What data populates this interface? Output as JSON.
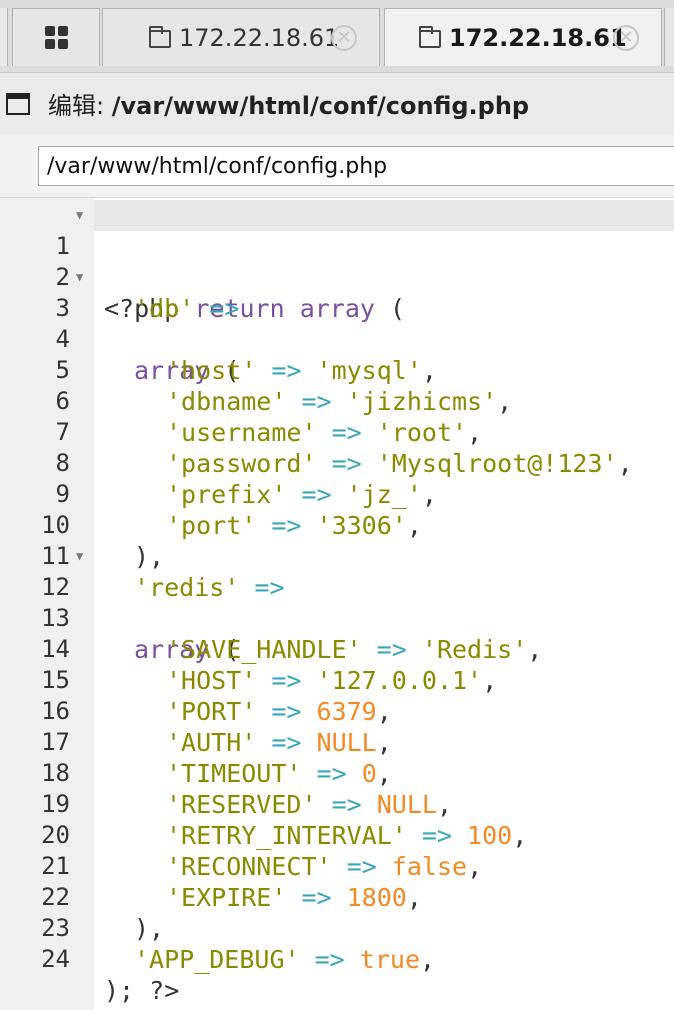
{
  "tabs": [
    {
      "label": "172.22.18.61",
      "active": false
    },
    {
      "label": "172.22.18.61",
      "active": true
    }
  ],
  "title": {
    "prefix": "编辑: ",
    "path": "/var/www/html/conf/config.php"
  },
  "path_input": {
    "value": "/var/www/html/conf/config.php"
  },
  "editor": {
    "lines": [
      {
        "n": "1"
      },
      {
        "n": "2"
      },
      {
        "n": "3"
      },
      {
        "n": "4"
      },
      {
        "n": "5"
      },
      {
        "n": "6"
      },
      {
        "n": "7"
      },
      {
        "n": "8"
      },
      {
        "n": "9"
      },
      {
        "n": "10"
      },
      {
        "n": "11"
      },
      {
        "n": "12"
      },
      {
        "n": "13"
      },
      {
        "n": "14"
      },
      {
        "n": "15"
      },
      {
        "n": "16"
      },
      {
        "n": "17"
      },
      {
        "n": "18"
      },
      {
        "n": "19"
      },
      {
        "n": "20"
      },
      {
        "n": "21"
      },
      {
        "n": "22"
      },
      {
        "n": "23"
      },
      {
        "n": "24"
      }
    ],
    "code": {
      "l1": [
        "<?php ",
        "return",
        " ",
        "array",
        " ("
      ],
      "l2": [
        "'db'",
        " =>"
      ],
      "l3": [
        "array",
        " ("
      ],
      "l4": [
        "'host'",
        " => ",
        "'mysql'",
        ","
      ],
      "l5": [
        "'dbname'",
        " => ",
        "'jizhicms'",
        ","
      ],
      "l6": [
        "'username'",
        " => ",
        "'root'",
        ","
      ],
      "l7": [
        "'password'",
        " => ",
        "'Mysqlroot@!123'",
        ","
      ],
      "l8": [
        "'prefix'",
        " => ",
        "'jz_'",
        ","
      ],
      "l9": [
        "'port'",
        " => ",
        "'3306'",
        ","
      ],
      "l10": [
        "),"
      ],
      "l11": [
        "'redis'",
        " =>"
      ],
      "l12": [
        "array",
        " ("
      ],
      "l13": [
        "'SAVE_HANDLE'",
        " => ",
        "'Redis'",
        ","
      ],
      "l14": [
        "'HOST'",
        " => ",
        "'127.0.0.1'",
        ","
      ],
      "l15": [
        "'PORT'",
        " => ",
        "6379",
        ","
      ],
      "l16": [
        "'AUTH'",
        " => ",
        "NULL",
        ","
      ],
      "l17": [
        "'TIMEOUT'",
        " => ",
        "0",
        ","
      ],
      "l18": [
        "'RESERVED'",
        " => ",
        "NULL",
        ","
      ],
      "l19": [
        "'RETRY_INTERVAL'",
        " => ",
        "100",
        ","
      ],
      "l20": [
        "'RECONNECT'",
        " => ",
        "false",
        ","
      ],
      "l21": [
        "'EXPIRE'",
        " => ",
        "1800",
        ","
      ],
      "l22": [
        "),"
      ],
      "l23": [
        "'APP_DEBUG'",
        " => ",
        "true",
        ","
      ],
      "l24": [
        ");",
        " ",
        "?>"
      ]
    }
  },
  "icons": {
    "grid": "grid-icon",
    "folder": "folder-icon",
    "close": "close-icon",
    "window": "window-icon",
    "fold": "fold-arrow-icon"
  },
  "colors": {
    "keyword": "#7a4fa0",
    "string": "#8a8a00",
    "operator": "#3aa6b9",
    "number": "#f08a24"
  }
}
